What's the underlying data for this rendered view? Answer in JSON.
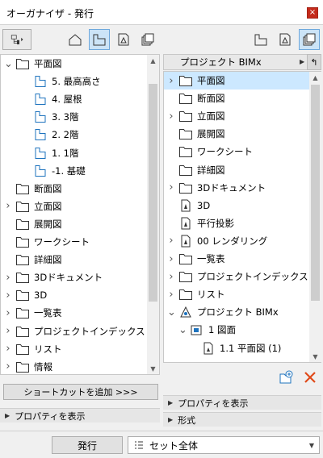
{
  "window": {
    "title": "オーガナイザ - 発行",
    "close_label": "×"
  },
  "left_pane": {
    "tree": [
      {
        "label": "平面図",
        "icon": "folder-icon",
        "expanded": true,
        "indent": 0
      },
      {
        "label": "5. 最高高さ",
        "icon": "story-view-icon",
        "indent": 1
      },
      {
        "label": "4. 屋根",
        "icon": "story-view-icon",
        "indent": 1
      },
      {
        "label": "3. 3階",
        "icon": "story-view-icon",
        "indent": 1
      },
      {
        "label": "2. 2階",
        "icon": "story-view-icon",
        "indent": 1
      },
      {
        "label": "1. 1階",
        "icon": "story-view-icon",
        "indent": 1
      },
      {
        "label": "-1. 基礎",
        "icon": "story-view-icon",
        "indent": 1
      },
      {
        "label": "断面図",
        "icon": "folder-icon",
        "indent": 0
      },
      {
        "label": "立面図",
        "icon": "folder-icon",
        "collapsed": true,
        "indent": 0
      },
      {
        "label": "展開図",
        "icon": "folder-icon",
        "indent": 0
      },
      {
        "label": "ワークシート",
        "icon": "folder-icon",
        "indent": 0
      },
      {
        "label": "詳細図",
        "icon": "folder-icon",
        "indent": 0
      },
      {
        "label": "3Dドキュメント",
        "icon": "folder-icon",
        "collapsed": true,
        "indent": 0
      },
      {
        "label": "3D",
        "icon": "folder-icon",
        "collapsed": true,
        "indent": 0
      },
      {
        "label": "一覧表",
        "icon": "folder-icon",
        "collapsed": true,
        "indent": 0
      },
      {
        "label": "プロジェクトインデックス",
        "icon": "folder-icon",
        "collapsed": true,
        "indent": 0
      },
      {
        "label": "リスト",
        "icon": "folder-icon",
        "collapsed": true,
        "indent": 0
      },
      {
        "label": "情報",
        "icon": "folder-icon",
        "collapsed": true,
        "indent": 0
      }
    ],
    "shortcut_button": "ショートカットを追加 >>>",
    "properties_label": "プロパティを表示"
  },
  "right_pane": {
    "header": "プロジェクト BIMx",
    "tree": [
      {
        "label": "平面図",
        "icon": "folder-icon",
        "collapsed": true,
        "selected": true,
        "indent": 0
      },
      {
        "label": "断面図",
        "icon": "folder-icon",
        "indent": 0
      },
      {
        "label": "立面図",
        "icon": "folder-icon",
        "collapsed": true,
        "indent": 0
      },
      {
        "label": "展開図",
        "icon": "folder-icon",
        "indent": 0
      },
      {
        "label": "ワークシート",
        "icon": "folder-icon",
        "indent": 0
      },
      {
        "label": "詳細図",
        "icon": "folder-icon",
        "indent": 0
      },
      {
        "label": "3Dドキュメント",
        "icon": "folder-icon",
        "collapsed": true,
        "indent": 0
      },
      {
        "label": "3D",
        "icon": "view-3d-icon",
        "indent": 0
      },
      {
        "label": "平行投影",
        "icon": "view-3d-icon",
        "indent": 0
      },
      {
        "label": "00 レンダリング",
        "icon": "view-3d-icon",
        "collapsed": true,
        "indent": 0
      },
      {
        "label": "一覧表",
        "icon": "folder-icon",
        "collapsed": true,
        "indent": 0
      },
      {
        "label": "プロジェクトインデックス",
        "icon": "folder-icon",
        "collapsed": true,
        "indent": 0
      },
      {
        "label": "リスト",
        "icon": "folder-icon",
        "collapsed": true,
        "indent": 0
      },
      {
        "label": "プロジェクト BIMx",
        "icon": "publisher-set-icon",
        "expanded": true,
        "indent": 0
      },
      {
        "label": "1 図面",
        "icon": "layout-icon",
        "expanded": true,
        "indent": 1
      },
      {
        "label": "1.1 平面図 (1)",
        "icon": "drawing-icon",
        "indent": 2
      }
    ],
    "properties_label": "プロパティを表示",
    "format_label": "形式"
  },
  "bottom": {
    "publish_button": "発行",
    "set_value": "セット全体"
  },
  "colors": {
    "selection": "#cce8ff",
    "active_button": "#cce4f7",
    "close": "#c42b1c",
    "delete": "#e04a1a",
    "accent": "#1e73be"
  }
}
